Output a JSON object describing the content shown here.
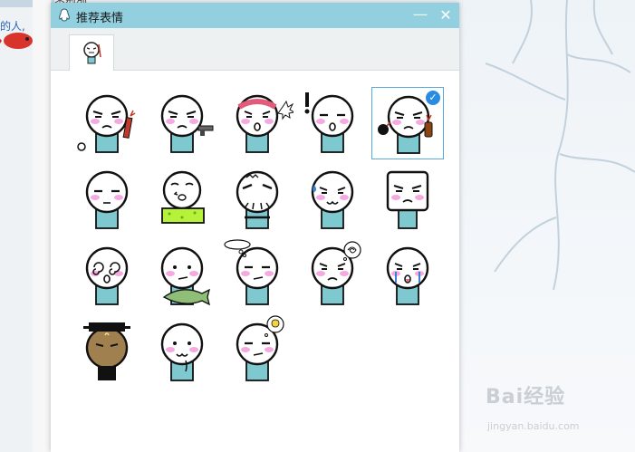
{
  "window": {
    "title": "推荐表情",
    "minimize_glyph": "—",
    "close_glyph": "✕"
  },
  "background": {
    "link_text": "的人,",
    "behind_title": "类型列"
  },
  "watermark": {
    "text": "Bai经验",
    "sub": "jingyan.baidu.com"
  },
  "tabs": [
    {
      "icon": "stickman-face-icon"
    }
  ],
  "selected_index": 4,
  "stickers": [
    {
      "name": "sticker-firecracker",
      "icon": "firecracker-icon"
    },
    {
      "name": "sticker-gun",
      "icon": "gun-icon"
    },
    {
      "name": "sticker-headband-angry",
      "icon": "headband-icon"
    },
    {
      "name": "sticker-exclaim-shock",
      "icon": "exclamation-icon"
    },
    {
      "name": "sticker-bomb",
      "icon": "bomb-icon"
    },
    {
      "name": "sticker-plain",
      "icon": "face-icon"
    },
    {
      "name": "sticker-bathtub",
      "icon": "bathtub-icon"
    },
    {
      "name": "sticker-old-man",
      "icon": "beard-icon"
    },
    {
      "name": "sticker-sweat",
      "icon": "sweat-icon"
    },
    {
      "name": "sticker-square-head",
      "icon": "square-head-icon"
    },
    {
      "name": "sticker-dizzy",
      "icon": "spiral-icon"
    },
    {
      "name": "sticker-fish",
      "icon": "fish-icon"
    },
    {
      "name": "sticker-thinking",
      "icon": "thought-bubble-icon"
    },
    {
      "name": "sticker-confused",
      "icon": "scribble-bubble-icon"
    },
    {
      "name": "sticker-crying",
      "icon": "tears-icon"
    },
    {
      "name": "sticker-judge-bao",
      "icon": "official-hat-icon"
    },
    {
      "name": "sticker-smirk",
      "icon": "smirk-icon"
    },
    {
      "name": "sticker-idea",
      "icon": "lightbulb-icon"
    }
  ],
  "colors": {
    "titlebar": "#92d0df",
    "body": "#7ec8cf",
    "blush": "#f5a9e0",
    "selection": "#59a8de",
    "check": "#2a8ce0"
  }
}
